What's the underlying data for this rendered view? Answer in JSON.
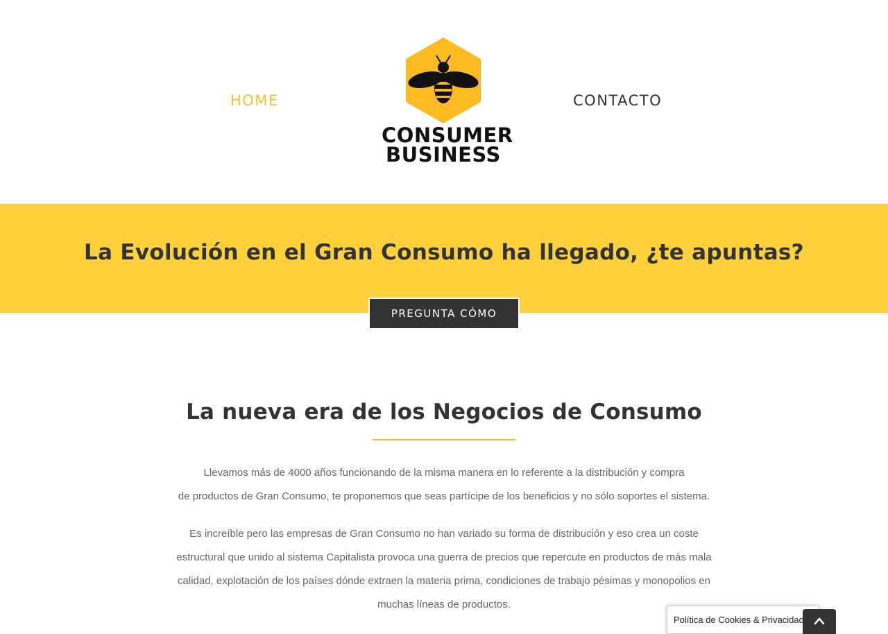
{
  "nav": {
    "home_label": "HOME",
    "contact_label": "CONTACTO"
  },
  "logo": {
    "line1": "CONSUMER",
    "line2": "BUSINESS"
  },
  "banner": {
    "title": "La Evolución en el Gran Consumo ha llegado, ¿te apuntas?",
    "cta_label": "PREGUNTA CÓMO"
  },
  "section": {
    "title": "La nueva era de los Negocios de Consumo",
    "paragraph1_line1": "Llevamos más de 4000 años funcionando de la misma manera en lo referente a la distribución y compra",
    "paragraph1_line2": "de productos de Gran Consumo, te proponemos que seas partícipe de los beneficios y no sólo soportes el sistema.",
    "paragraph2_line1": "Es increíble pero las empresas de Gran Consumo no han variado su forma de distribución y eso crea un coste",
    "paragraph2_line2": "estructural que unido al sistema Capitalista provoca una guerra de precios que repercute en productos de más mala",
    "paragraph2_line3": "calidad, explotación de los países dónde extraen la materia prima, condiciones de trabajo pésimas y monopolios en",
    "paragraph2_line4": "muchas líneas de productos."
  },
  "cookie_bar": {
    "label": "Política de Cookies & Privacidad"
  },
  "icons": {
    "logo_icon": "bee-hexagon-icon",
    "to_top_icon": "chevron-up-icon"
  },
  "colors": {
    "accent": "#f3c232",
    "banner": "#fdd03c",
    "dark": "#333333"
  }
}
